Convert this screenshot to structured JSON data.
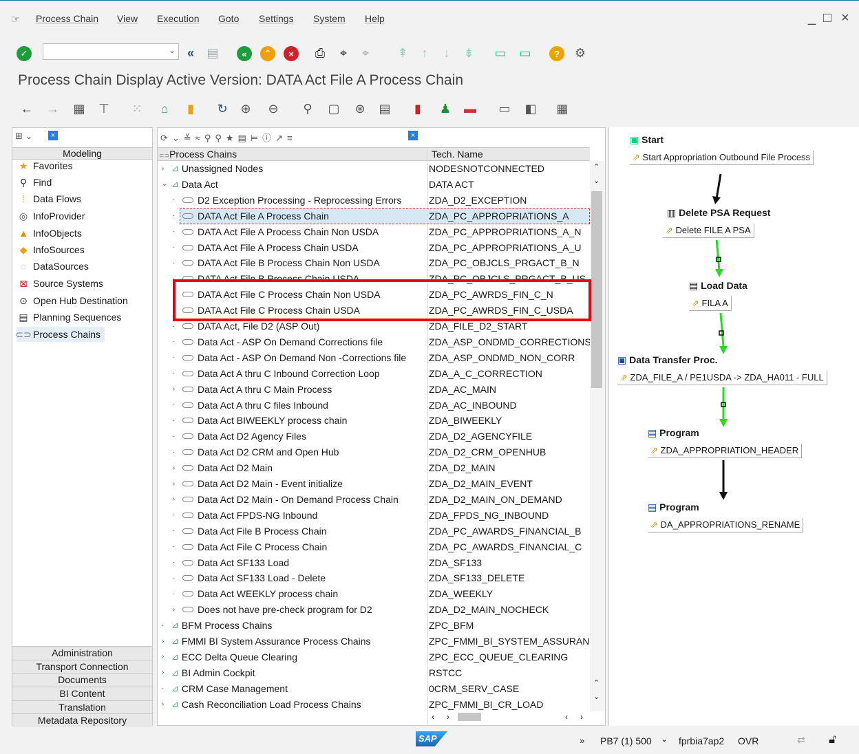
{
  "menu": {
    "items": [
      "Process Chain",
      "View",
      "Execution",
      "Goto",
      "Settings",
      "System",
      "Help"
    ],
    "window_controls": [
      "_",
      "□",
      "×"
    ]
  },
  "title": "Process Chain Display Active Version: DATA Act File A Process Chain",
  "left_nav": {
    "header": "Modeling",
    "items": [
      "Favorites",
      "Find",
      "Data Flows",
      "InfoProvider",
      "InfoObjects",
      "InfoSources",
      "DataSources",
      "Source Systems",
      "Open Hub Destination",
      "Planning Sequences",
      "Process Chains"
    ],
    "selected": "Process Chains",
    "bottom_items": [
      "Administration",
      "Transport Connection",
      "Documents",
      "BI Content",
      "Translation",
      "Metadata Repository"
    ]
  },
  "tree": {
    "col_name": "Process Chains",
    "col_tech": "Tech. Name",
    "rows": [
      {
        "name": "Unassigned Nodes",
        "tech": "NODESNOTCONNECTED",
        "level": 0,
        "exp": ">",
        "icon": "folder"
      },
      {
        "name": "Data Act",
        "tech": "DATA ACT",
        "level": 0,
        "exp": "v",
        "icon": "folder"
      },
      {
        "name": "D2 Exception Processing - Reprocessing Errors",
        "tech": "ZDA_D2_EXCEPTION",
        "level": 1,
        "exp": "·",
        "icon": "chain"
      },
      {
        "name": "DATA Act File A Process Chain",
        "tech": "ZDA_PC_APPROPRIATIONS_A",
        "level": 1,
        "exp": "·",
        "icon": "chain",
        "selected": true
      },
      {
        "name": "DATA Act File A Process Chain Non USDA",
        "tech": "ZDA_PC_APPROPRIATIONS_A_N",
        "level": 1,
        "exp": "·",
        "icon": "chain"
      },
      {
        "name": "DATA Act File A Process Chain USDA",
        "tech": "ZDA_PC_APPROPRIATIONS_A_U",
        "level": 1,
        "exp": "·",
        "icon": "chain"
      },
      {
        "name": "DATA Act File B Process Chain Non USDA",
        "tech": "ZDA_PC_OBJCLS_PRGACT_B_N",
        "level": 1,
        "exp": "·",
        "icon": "chain"
      },
      {
        "name": "DATA Act File B Process Chain USDA",
        "tech": "ZDA_PC_OBJCLS_PRGACT_B_US",
        "level": 1,
        "exp": "·",
        "icon": "chain"
      },
      {
        "name": "DATA Act File C Process Chain Non USDA",
        "tech": "ZDA_PC_AWRDS_FIN_C_N",
        "level": 1,
        "exp": "·",
        "icon": "chain"
      },
      {
        "name": "DATA Act File C Process Chain USDA",
        "tech": "ZDA_PC_AWRDS_FIN_C_USDA",
        "level": 1,
        "exp": "·",
        "icon": "chain"
      },
      {
        "name": "DATA Act, File D2 (ASP Out)",
        "tech": "ZDA_FILE_D2_START",
        "level": 1,
        "exp": "·",
        "icon": "chain"
      },
      {
        "name": "Data Act - ASP On Demand Corrections file",
        "tech": "ZDA_ASP_ONDMD_CORRECTIONS",
        "level": 1,
        "exp": "·",
        "icon": "chain"
      },
      {
        "name": "Data Act - ASP On Demand Non -Corrections file",
        "tech": "ZDA_ASP_ONDMD_NON_CORR",
        "level": 1,
        "exp": "·",
        "icon": "chain"
      },
      {
        "name": "Data Act A thru C Inbound Correction Loop",
        "tech": "ZDA_A_C_CORRECTION",
        "level": 1,
        "exp": "·",
        "icon": "chain"
      },
      {
        "name": "Data Act A thru C Main Process",
        "tech": "ZDA_AC_MAIN",
        "level": 1,
        "exp": ">",
        "icon": "chain"
      },
      {
        "name": "Data Act A thru C files Inbound",
        "tech": "ZDA_AC_INBOUND",
        "level": 1,
        "exp": "·",
        "icon": "chain"
      },
      {
        "name": "Data Act BIWEEKLY process chain",
        "tech": "ZDA_BIWEEKLY",
        "level": 1,
        "exp": "·",
        "icon": "chain"
      },
      {
        "name": "Data Act D2 Agency Files",
        "tech": "ZDA_D2_AGENCYFILE",
        "level": 1,
        "exp": "·",
        "icon": "chain"
      },
      {
        "name": "Data Act D2 CRM and Open Hub",
        "tech": "ZDA_D2_CRM_OPENHUB",
        "level": 1,
        "exp": "·",
        "icon": "chain"
      },
      {
        "name": "Data Act D2 Main",
        "tech": "ZDA_D2_MAIN",
        "level": 1,
        "exp": ">",
        "icon": "chain"
      },
      {
        "name": "Data Act D2 Main - Event initialize",
        "tech": "ZDA_D2_MAIN_EVENT",
        "level": 1,
        "exp": ">",
        "icon": "chain"
      },
      {
        "name": "Data Act D2 Main - On Demand Process Chain",
        "tech": "ZDA_D2_MAIN_ON_DEMAND",
        "level": 1,
        "exp": ">",
        "icon": "chain"
      },
      {
        "name": "Data Act FPDS-NG Inbound",
        "tech": "ZDA_FPDS_NG_INBOUND",
        "level": 1,
        "exp": "·",
        "icon": "chain"
      },
      {
        "name": "Data Act File B Process Chain",
        "tech": "ZDA_PC_AWARDS_FINANCIAL_B",
        "level": 1,
        "exp": "·",
        "icon": "chain"
      },
      {
        "name": "Data Act File C Process Chain",
        "tech": "ZDA_PC_AWARDS_FINANCIAL_C",
        "level": 1,
        "exp": "·",
        "icon": "chain"
      },
      {
        "name": "Data Act SF133 Load",
        "tech": "ZDA_SF133",
        "level": 1,
        "exp": "·",
        "icon": "chain"
      },
      {
        "name": "Data Act SF133 Load - Delete",
        "tech": "ZDA_SF133_DELETE",
        "level": 1,
        "exp": "·",
        "icon": "chain"
      },
      {
        "name": "Data Act WEEKLY process chain",
        "tech": "ZDA_WEEKLY",
        "level": 1,
        "exp": "·",
        "icon": "chain"
      },
      {
        "name": "Does not have pre-check program for D2",
        "tech": "ZDA_D2_MAIN_NOCHECK",
        "level": 1,
        "exp": ">",
        "icon": "chain"
      },
      {
        "name": "BFM Process Chains",
        "tech": "ZPC_BFM",
        "level": 0,
        "exp": "·",
        "icon": "folder"
      },
      {
        "name": "FMMI BI System Assurance Process Chains",
        "tech": "ZPC_FMMI_BI_SYSTEM_ASSURANC",
        "level": 0,
        "exp": ">",
        "icon": "folder"
      },
      {
        "name": "ECC Delta Queue Clearing",
        "tech": "ZPC_ECC_QUEUE_CLEARING",
        "level": 0,
        "exp": ">",
        "icon": "folder"
      },
      {
        "name": "BI Admin Cockpit",
        "tech": "RSTCC",
        "level": 0,
        "exp": ">",
        "icon": "folder"
      },
      {
        "name": "CRM Case Management",
        "tech": "0CRM_SERV_CASE",
        "level": 0,
        "exp": "·",
        "icon": "folder"
      },
      {
        "name": "Cash Reconciliation Load Process Chains",
        "tech": "ZPC_FMMI_BI_CR_LOAD",
        "level": 0,
        "exp": ">",
        "icon": "folder"
      }
    ]
  },
  "diagram": {
    "nodes": [
      {
        "type": "Start",
        "detail": "Start Appropriation Outbound File Process"
      },
      {
        "type": "Delete PSA Request",
        "detail": "Delete FILE A PSA"
      },
      {
        "type": "Load Data",
        "detail": "FILA A"
      },
      {
        "type": "Data Transfer Proc.",
        "detail": "ZDA_FILE_A / PE1USDA -> ZDA_HA011 - FULL"
      },
      {
        "type": "Program",
        "detail": "ZDA_APPROPRIATION_HEADER"
      },
      {
        "type": "Program",
        "detail": "DA_APPROPRIATIONS_RENAME"
      }
    ],
    "colors": {
      "success_link": "#22dd22",
      "plain_link": "#111111"
    }
  },
  "statusbar": {
    "logo": "SAP",
    "system": "PB7 (1) 500",
    "server": "fprbia7ap2",
    "mode": "OVR"
  },
  "colors": {
    "highlight": "#e8000f",
    "selection": "#d7e7f4",
    "accent": "#0a7f8f"
  }
}
